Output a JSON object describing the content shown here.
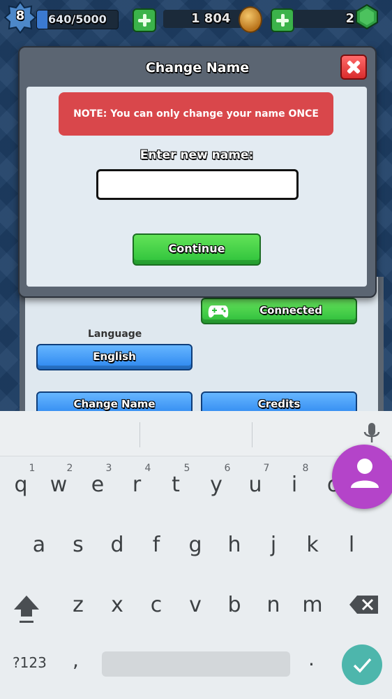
{
  "hud": {
    "level": "8",
    "xp": "640/5000",
    "xp_progress": 0.128,
    "gold": "1 804",
    "gems": "2"
  },
  "dialog": {
    "title": "Change Name",
    "note": "NOTE: You can only change your name ONCE",
    "enter_label": "Enter new name:",
    "name_value": "",
    "continue_label": "Continue"
  },
  "settings": {
    "connected_label": "Connected",
    "language_label": "Language",
    "language_value": "English",
    "change_name_label": "Change Name",
    "credits_label": "Credits"
  },
  "keyboard": {
    "row1": [
      "q",
      "w",
      "e",
      "r",
      "t",
      "y",
      "u",
      "i",
      "o"
    ],
    "row1_hints": [
      "1",
      "2",
      "3",
      "4",
      "5",
      "6",
      "7",
      "8"
    ],
    "row2": [
      "a",
      "s",
      "d",
      "f",
      "g",
      "h",
      "j",
      "k",
      "l"
    ],
    "row3": [
      "z",
      "x",
      "c",
      "v",
      "b",
      "n",
      "m"
    ],
    "symbols_label": "?123",
    "comma": ",",
    "period": "."
  },
  "colors": {
    "note_bg": "#d9474b",
    "continue_bg": "#2cc13a",
    "blue_button": "#2b86ef",
    "enter_key": "#4db6ac",
    "avatar_bubble": "#b444c9"
  }
}
